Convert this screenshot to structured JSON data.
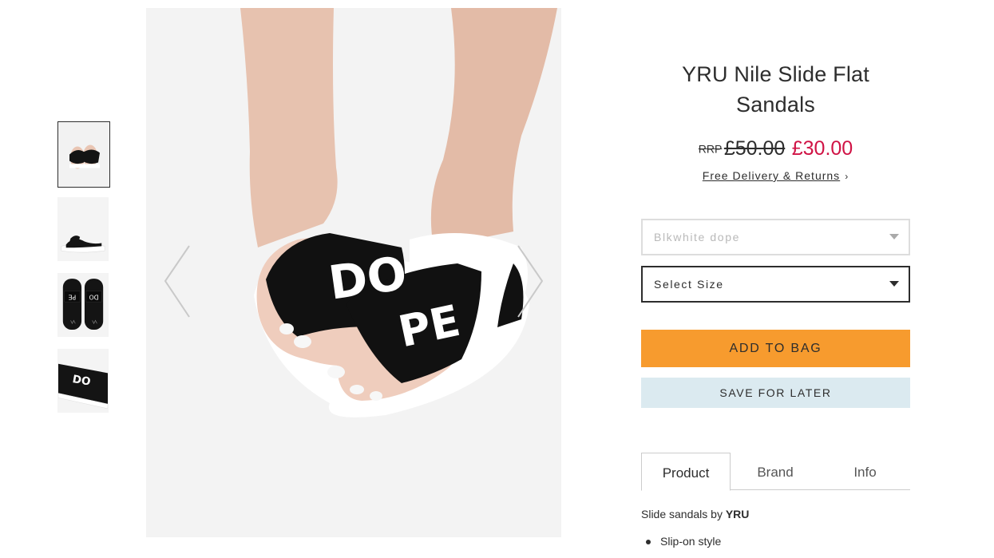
{
  "product": {
    "title": "YRU Nile Slide Flat Sandals",
    "rrp_label": "RRP",
    "old_price": "£50.00",
    "new_price": "£30.00",
    "delivery_link": "Free Delivery & Returns",
    "delivery_chevron": "›"
  },
  "colour_select": {
    "value": "Blkwhite dope"
  },
  "size_select": {
    "value": "Select Size"
  },
  "buttons": {
    "add_to_bag": "ADD TO BAG",
    "save_for_later": "SAVE FOR LATER"
  },
  "tabs": [
    {
      "label": "Product"
    },
    {
      "label": "Brand"
    },
    {
      "label": "Info"
    }
  ],
  "description": {
    "intro": "Slide sandals by ",
    "brand": "YRU",
    "bullets": [
      "Slip-on style"
    ]
  },
  "gallery": {
    "thumbnail_count": 4,
    "strap_text_left": "DO",
    "strap_text_right": "PE"
  },
  "colors": {
    "sale_red": "#d01345",
    "add_to_bag_orange": "#f79b2e",
    "save_blue": "#dbeaf0",
    "text": "#2d2d2d"
  },
  "icons": {
    "prev": "chevron-left-icon",
    "next": "chevron-right-icon",
    "dropdown": "caret-down-icon"
  }
}
